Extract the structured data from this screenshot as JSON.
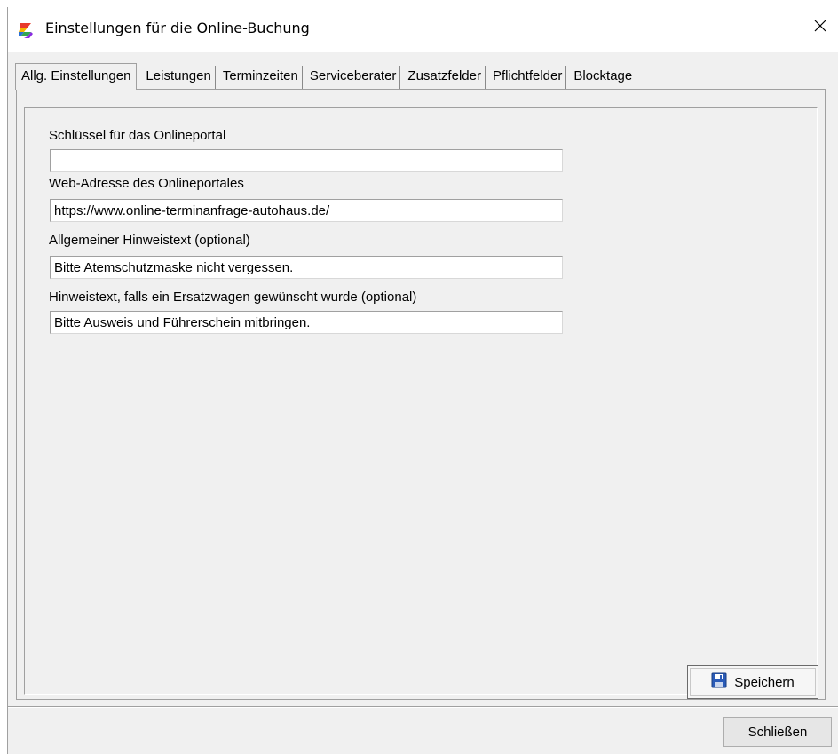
{
  "window": {
    "title": "Einstellungen für die Online-Buchung",
    "icon": "app-logo-icon",
    "close_icon": "close-icon"
  },
  "tabs": [
    {
      "label": "Allg. Einstellungen",
      "active": true
    },
    {
      "label": "Leistungen",
      "active": false
    },
    {
      "label": "Terminzeiten",
      "active": false
    },
    {
      "label": "Serviceberater",
      "active": false
    },
    {
      "label": "Zusatzfelder",
      "active": false
    },
    {
      "label": "Pflichtfelder",
      "active": false
    },
    {
      "label": "Blocktage",
      "active": false
    }
  ],
  "fields": [
    {
      "label": "Schlüssel für das Onlineportal",
      "value": ""
    },
    {
      "label": "Web-Adresse des Onlineportales",
      "value": "https://www.online-terminanfrage-autohaus.de/"
    },
    {
      "label": "Allgemeiner Hinweistext (optional)",
      "value": "Bitte Atemschutzmaske nicht vergessen."
    },
    {
      "label": "Hinweistext, falls ein Ersatzwagen gewünscht wurde (optional)",
      "value": "Bitte Ausweis und Führerschein mitbringen."
    }
  ],
  "buttons": {
    "save_label": "Speichern",
    "save_icon": "floppy-disk-icon",
    "close_label": "Schließen"
  },
  "colors": {
    "window_bg": "#f0f0f0",
    "titlebar_bg": "#ffffff",
    "border": "#a0a0a0",
    "input_bg": "#ffffff"
  }
}
